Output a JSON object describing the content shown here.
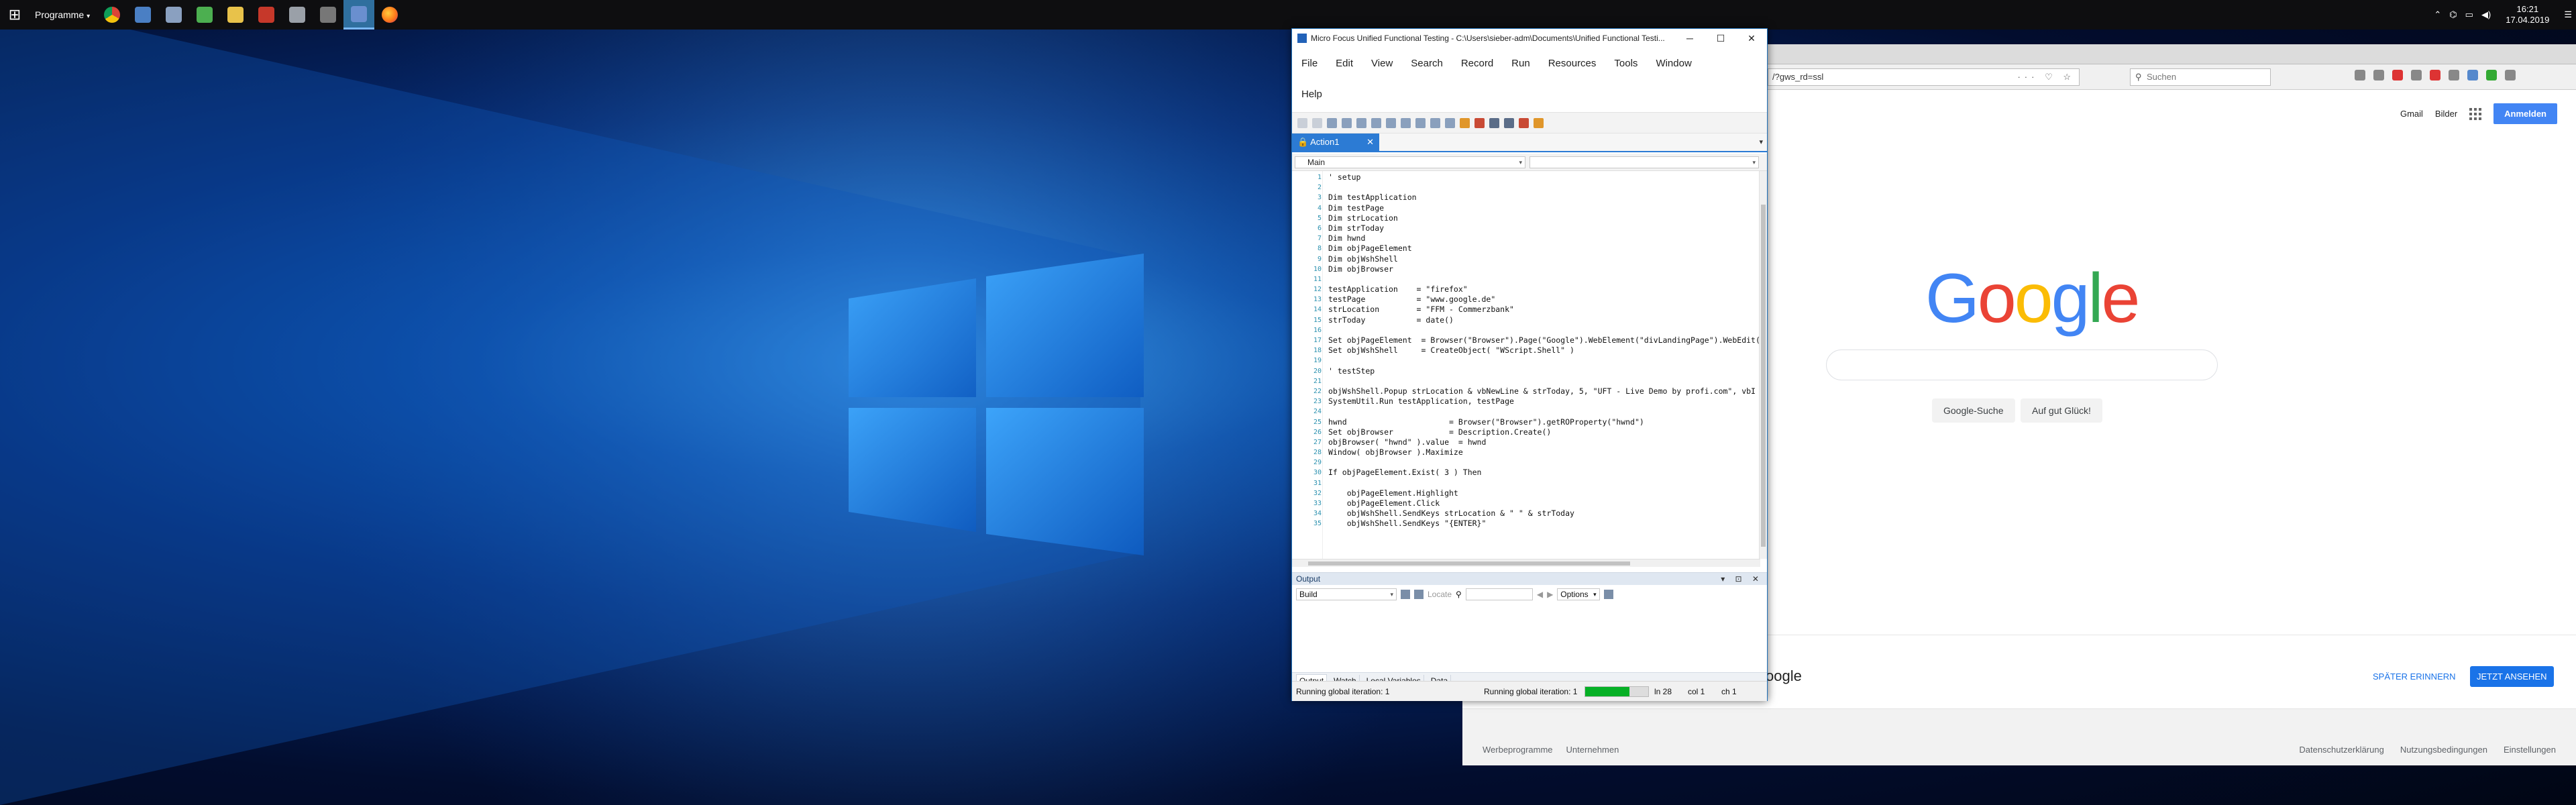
{
  "taskbar": {
    "start_label": "⊞",
    "programs_label": "Programme",
    "apps": [
      {
        "name": "chrome",
        "color": "#e0b23b"
      },
      {
        "name": "network",
        "color": "#4a7fc4"
      },
      {
        "name": "connect",
        "color": "#8aa0c0"
      },
      {
        "name": "notes",
        "color": "#4caf50"
      },
      {
        "name": "explorer",
        "color": "#e8c24a"
      },
      {
        "name": "presentation",
        "color": "#c6382a"
      },
      {
        "name": "tool",
        "color": "#9aa0a8"
      },
      {
        "name": "pen",
        "color": "#777"
      },
      {
        "name": "uft",
        "color": "#6a8fcf",
        "active": true
      },
      {
        "name": "firefox",
        "color": "#ff7a1a"
      }
    ],
    "tray": {
      "chevron": "⌃",
      "clock_time": "16:21",
      "clock_date": "17.04.2019",
      "notifications": "☰"
    }
  },
  "browser": {
    "url": "/?gws_rd=ssl",
    "url_actions": "··· ♡ ☆",
    "search_placeholder": "Suchen",
    "top_links": [
      "Gmail",
      "Bilder"
    ],
    "login_button": "Anmelden",
    "logo_letters": [
      "G",
      "o",
      "o",
      "g",
      "l",
      "e"
    ],
    "btn_search": "Google-Suche",
    "btn_lucky": "Auf gut Glück!",
    "cookie_title": "oogle",
    "cookie_later": "SPÄTER ERINNERN",
    "cookie_accept": "JETZT ANSEHEN",
    "footer_left": [
      "Werbeprogramme",
      "Unternehmen"
    ],
    "footer_right": [
      "Datenschutzerklärung",
      "Nutzungsbedingungen",
      "Einstellungen"
    ]
  },
  "uft": {
    "title": "Micro Focus Unified Functional Testing - C:\\Users\\sieber-adm\\Documents\\Unified Functional Testi...",
    "win_min": "─",
    "win_max": "☐",
    "win_close": "✕",
    "menu_row1": [
      "File",
      "Edit",
      "View",
      "Search",
      "Record",
      "Run",
      "Resources",
      "Tools",
      "Window"
    ],
    "menu_row2": [
      "Help"
    ],
    "doc_tab": "Action1",
    "doc_tab_close": "✕",
    "doc_pin": "▾",
    "selector_left": "Main",
    "selector_right": "",
    "code_lines": [
      "' setup",
      "",
      "Dim testApplication",
      "Dim testPage",
      "Dim strLocation",
      "Dim strToday",
      "Dim hwnd",
      "Dim objPageElement",
      "Dim objWshShell",
      "Dim objBrowser",
      "",
      "testApplication    = \"firefox\"",
      "testPage           = \"www.google.de\"",
      "strLocation        = \"FFM - Commerzbank\"",
      "strToday           = date()",
      "",
      "Set objPageElement  = Browser(\"Browser\").Page(\"Google\").WebElement(\"divLandingPage\").WebEdit(",
      "Set objWshShell     = CreateObject( \"WScript.Shell\" )",
      "",
      "' testStep",
      "",
      "objWshShell.Popup strLocation & vbNewLine & strToday, 5, \"UFT - Live Demo by profi.com\", vbI",
      "SystemUtil.Run testApplication, testPage",
      "",
      "hwnd                      = Browser(\"Browser\").getROProperty(\"hwnd\")",
      "Set objBrowser            = Description.Create()",
      "objBrowser( \"hwnd\" ).value  = hwnd",
      "Window( objBrowser ).Maximize",
      "",
      "If objPageElement.Exist( 3 ) Then",
      "",
      "    objPageElement.Highlight",
      "    objPageElement.Click",
      "    objWshShell.SendKeys strLocation & \" \" & strToday",
      "    objWshShell.SendKeys \"{ENTER}\""
    ],
    "output": {
      "title": "Output",
      "header_controls": "▾ ⊡ ✕",
      "source": "Build",
      "locate_label": "Locate",
      "options_label": "Options"
    },
    "bottom_tabs": [
      "Output",
      "Watch",
      "Local Variables",
      "Data"
    ],
    "status": {
      "left": "Running global iteration: 1",
      "mid": "Running global iteration: 1",
      "progress": 0.7,
      "ln": "ln 28",
      "col": "col 1",
      "ch": "ch 1"
    }
  }
}
